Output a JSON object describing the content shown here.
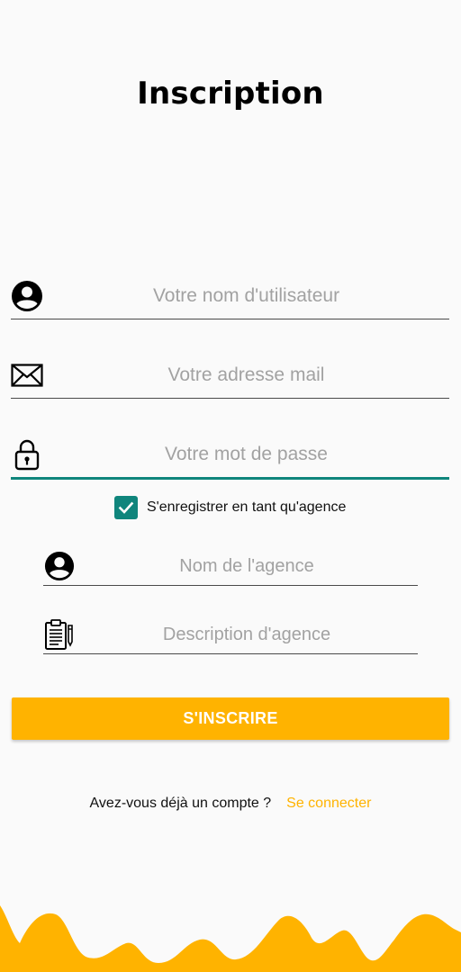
{
  "header": {
    "title": "Inscription"
  },
  "form": {
    "username": {
      "placeholder": "Votre nom d'utilisateur",
      "value": "",
      "icon": "account-circle-icon"
    },
    "email": {
      "placeholder": "Votre adresse mail",
      "value": "",
      "icon": "envelope-icon"
    },
    "password": {
      "placeholder": "Votre mot de passe",
      "value": "",
      "icon": "padlock-icon"
    },
    "agency_checkbox": {
      "label": "S'enregistrer en tant qu'agence",
      "checked": true
    },
    "agency_name": {
      "placeholder": "Nom de l'agence",
      "value": "",
      "icon": "account-circle-icon"
    },
    "agency_description": {
      "placeholder": "Description d'agence",
      "value": "",
      "icon": "clipboard-icon"
    },
    "submit_label": "S'INSCRIRE"
  },
  "footer": {
    "question": "Avez-vous déjà un compte ?",
    "login_link": "Se connecter"
  },
  "colors": {
    "accent": "#ffb300",
    "focus": "#0f857c",
    "background": "#fafafa"
  }
}
